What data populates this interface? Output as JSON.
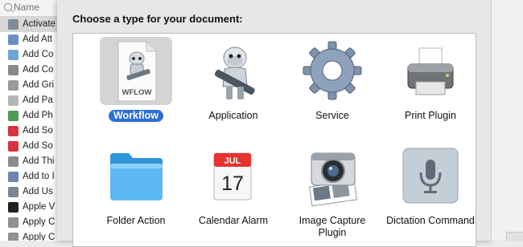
{
  "search": {
    "placeholder": "Name"
  },
  "actions": [
    {
      "label": "Activate",
      "icon": "finder-icon",
      "color": "#7f8c98"
    },
    {
      "label": "Add Att",
      "icon": "mail-icon",
      "color": "#6a8fc2"
    },
    {
      "label": "Add Co",
      "icon": "magnifier-icon",
      "color": "#6fa6d8"
    },
    {
      "label": "Add Co",
      "icon": "scripts-icon",
      "color": "#8a8a8a"
    },
    {
      "label": "Add Gri",
      "icon": "grid-icon",
      "color": "#9a9a9a"
    },
    {
      "label": "Add Pa",
      "icon": "document-icon",
      "color": "#b5b5b5"
    },
    {
      "label": "Add Ph",
      "icon": "iphoto-icon",
      "color": "#4c9b57"
    },
    {
      "label": "Add So",
      "icon": "itunes-icon",
      "color": "#d8333e"
    },
    {
      "label": "Add So",
      "icon": "itunes-icon",
      "color": "#d8333e"
    },
    {
      "label": "Add Thi",
      "icon": "thumbnail-icon",
      "color": "#8b8b8b"
    },
    {
      "label": "Add to I",
      "icon": "document-icon",
      "color": "#6b86b5"
    },
    {
      "label": "Add Us",
      "icon": "users-icon",
      "color": "#7d8793"
    },
    {
      "label": "Apple V",
      "icon": "terminal-icon",
      "color": "#222222"
    },
    {
      "label": "Apply C",
      "icon": "image-icon",
      "color": "#909090"
    },
    {
      "label": "Apply C",
      "icon": "image-icon",
      "color": "#909090"
    }
  ],
  "dialog": {
    "title": "Choose a type for your document:",
    "selected_type": "Workflow",
    "types": [
      {
        "name": "Workflow",
        "icon": "workflow-document-icon",
        "badge": "WFLOW"
      },
      {
        "name": "Application",
        "icon": "automator-robot-icon"
      },
      {
        "name": "Service",
        "icon": "gear-icon"
      },
      {
        "name": "Print Plugin",
        "icon": "printer-icon"
      },
      {
        "name": "Folder Action",
        "icon": "folder-icon"
      },
      {
        "name": "Calendar Alarm",
        "icon": "calendar-icon",
        "month": "JUL",
        "day": "17"
      },
      {
        "name": "Image Capture Plugin",
        "icon": "image-capture-icon"
      },
      {
        "name": "Dictation Command",
        "icon": "microphone-icon"
      }
    ]
  },
  "colors": {
    "selection": "#2c6fd9",
    "folder": "#3fa9ef",
    "calendar_red": "#e8322e"
  }
}
